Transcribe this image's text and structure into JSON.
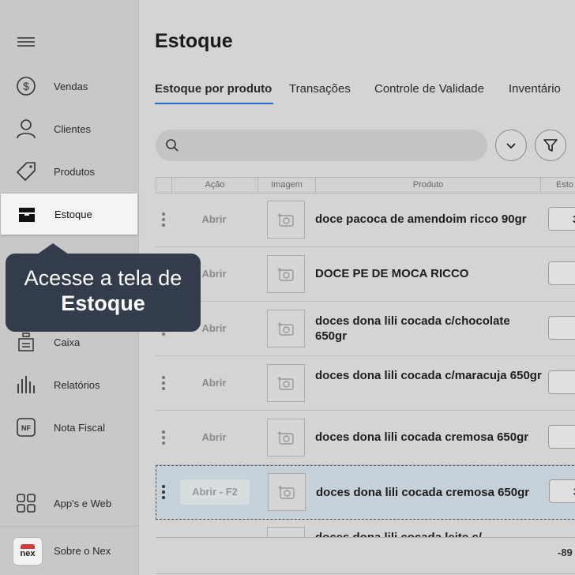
{
  "sidebar": {
    "items": [
      {
        "label": "Vendas",
        "icon": "dollar-circle-icon"
      },
      {
        "label": "Clientes",
        "icon": "user-icon"
      },
      {
        "label": "Produtos",
        "icon": "tag-icon"
      },
      {
        "label": "Estoque",
        "icon": "box-icon"
      },
      {
        "label": "Caixa",
        "icon": "cash-register-icon"
      },
      {
        "label": "Relatórios",
        "icon": "bar-chart-icon"
      },
      {
        "label": "Nota Fiscal",
        "icon": "nf-icon"
      },
      {
        "label": "App's e Web",
        "icon": "apps-grid-icon"
      },
      {
        "label": "Sobre o Nex",
        "icon": "nex-logo"
      }
    ],
    "logo_text": "nex"
  },
  "tooltip": {
    "line1": "Acesse a tela de",
    "line2": "Estoque"
  },
  "page": {
    "title": "Estoque"
  },
  "tabs": [
    "Estoque por produto",
    "Transações",
    "Controle de Validade",
    "Inventário"
  ],
  "search": {
    "placeholder": "",
    "value": ""
  },
  "table": {
    "headers": {
      "acao": "Ação",
      "imagem": "Imagem",
      "produto": "Produto",
      "estoque": "Esto"
    },
    "rows": [
      {
        "action": "Abrir",
        "product": "doce pacoca de amendoim ricco 90gr",
        "qty": "3"
      },
      {
        "action": "Abrir",
        "product": "DOCE PE DE MOCA RICCO",
        "qty": ""
      },
      {
        "action": "Abrir",
        "product": "doces dona lili cocada c/chocolate 650gr",
        "qty": ""
      },
      {
        "action": "Abrir",
        "product": "doces dona lili cocada c/maracuja 650gr",
        "qty": ""
      },
      {
        "action": "Abrir",
        "product": "doces dona lili cocada cremosa 650gr",
        "qty": ""
      },
      {
        "action": "Abrir - F2",
        "product": "doces dona lili cocada cremosa 650gr",
        "qty": "3"
      }
    ],
    "partial_row_product": "doces dona lili cocada leite c/",
    "total": "-89"
  },
  "colors": {
    "accent": "#1f6fd1",
    "tooltip_bg": "#333c4b",
    "brand_red": "#d23b3b"
  }
}
